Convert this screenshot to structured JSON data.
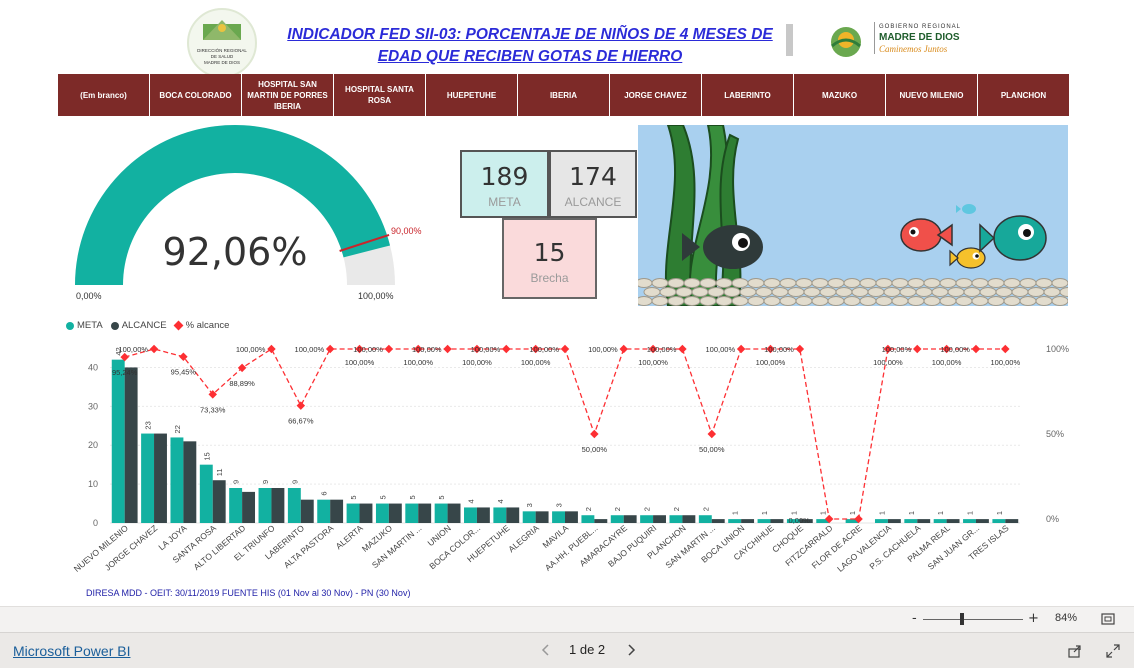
{
  "header": {
    "title": "INDICADOR FED SII-03: PORCENTAJE DE NIÑOS DE 4 MESES DE EDAD QUE RECIBEN GOTAS DE HIERRO",
    "logo_left_text": "DIRECCIÓN REGIONAL DE SALUD MADRE DE DIOS",
    "logo_right_line1": "GOBIERNO REGIONAL",
    "logo_right_line2": "MADRE DE DIOS",
    "logo_right_line3": "Caminemos Juntos"
  },
  "slicers": [
    "(Em branco)",
    "BOCA COLORADO",
    "HOSPITAL SAN MARTIN DE PORRES IBERIA",
    "HOSPITAL SANTA ROSA",
    "HUEPETUHE",
    "IBERIA",
    "JORGE CHAVEZ",
    "LABERINTO",
    "MAZUKO",
    "NUEVO MILENIO",
    "PLANCHON"
  ],
  "gauge": {
    "value_label": "92,06%",
    "value": 0.9206,
    "target": 0.9,
    "target_label": "90,00%",
    "min_label": "0,00%",
    "max_label": "100,00%",
    "color": "#12b1a1",
    "bg_color": "#e9e9e9",
    "target_color": "#c9252b"
  },
  "cards": {
    "meta": {
      "value": "189",
      "label": "META",
      "bg": "#ccefed"
    },
    "alcance": {
      "value": "174",
      "label": "ALCANCE",
      "bg": "#e6e6e6"
    },
    "brecha": {
      "value": "15",
      "label": "Brecha",
      "bg": "#fadadb"
    }
  },
  "legend": {
    "meta": "META",
    "alcance": "ALCANCE",
    "pct": "% alcance"
  },
  "chart_data": {
    "type": "bar",
    "categories": [
      "NUEVO MILENIO",
      "JORGE CHAVEZ",
      "LA JOYA",
      "SANTA ROSA",
      "ALTO LIBERTAD",
      "EL TRIUNFO",
      "LABERINTO",
      "ALTA PASTORA",
      "ALERTA",
      "MAZUKO",
      "SAN MARTIN ...",
      "UNION",
      "BOCA COLOR...",
      "HUEPETUHE",
      "ALEGRIA",
      "MAVILA",
      "AA.HH. PUEBL...",
      "AMARACAYRE",
      "BAJO PUQUIRI",
      "PLANCHON",
      "SAN MARTIN ...",
      "BOCA UNION",
      "CAYCHIHUE",
      "CHOQUE",
      "FITZCARRALD",
      "FLOR DE ACRE",
      "LAGO VALENCIA",
      "P.S. CACHUELA",
      "PALMA REAL",
      "SAN JUAN GR...",
      "TRES ISLAS"
    ],
    "series": [
      {
        "name": "META",
        "color": "#12b1a1",
        "values": [
          42,
          23,
          22,
          15,
          9,
          9,
          9,
          6,
          5,
          5,
          5,
          5,
          4,
          4,
          3,
          3,
          2,
          2,
          2,
          2,
          2,
          1,
          1,
          1,
          1,
          1,
          1,
          1,
          1,
          1,
          1
        ]
      },
      {
        "name": "ALCANCE",
        "color": "#374649",
        "values": [
          40,
          23,
          21,
          11,
          8,
          9,
          6,
          6,
          5,
          5,
          5,
          5,
          4,
          4,
          3,
          3,
          1,
          2,
          2,
          2,
          1,
          1,
          1,
          1,
          0,
          0,
          1,
          1,
          1,
          1,
          1
        ]
      },
      {
        "name": "% alcance",
        "color": "#fd2f33",
        "axis": "right",
        "values": [
          95.24,
          100,
          95.45,
          73.33,
          88.89,
          100,
          66.67,
          100,
          100,
          100,
          100,
          100,
          100,
          100,
          100,
          100,
          50,
          100,
          100,
          100,
          50,
          100,
          100,
          100,
          0,
          0,
          100,
          100,
          100,
          100,
          100
        ],
        "labels": [
          "95,24%",
          "100,00%",
          "95,45%",
          "73,33%",
          "88,89%",
          "100,00%",
          "66,67%",
          "100,00%",
          "100,00%",
          "100,00%",
          "100,00%",
          "100,00%",
          "100,00%",
          "100,00%",
          "100,00%",
          "100,00%",
          "50,00%",
          "100,00%",
          "100,00%",
          "100,00%",
          "50,00%",
          "100,00%",
          "100,00%",
          "100,00%",
          "0,00%",
          "",
          "100,00%",
          "100,00%",
          "100,00%",
          "100,00%",
          "100,00%"
        ]
      }
    ],
    "meta_labels": [
      "42",
      "23",
      "22",
      "15",
      "9",
      "9",
      "9",
      "6",
      "5",
      "5",
      "5",
      "5",
      "4",
      "4",
      "3",
      "3",
      "2",
      "2",
      "2",
      "2",
      "2",
      "1",
      "1",
      "1",
      "1",
      "1",
      "1",
      "1",
      "1",
      "1",
      "1"
    ],
    "alcance_labels": [
      "",
      "",
      "",
      "11",
      "",
      "",
      "",
      "",
      "",
      "",
      "",
      "",
      "",
      "",
      "",
      "",
      "",
      "",
      "",
      "",
      "",
      "",
      "",
      "",
      "",
      "",
      "",
      "",
      "",
      "",
      ""
    ],
    "ylim": [
      0,
      45
    ],
    "yticks": [
      "0",
      "10",
      "20",
      "30",
      "40"
    ],
    "y2ticks": [
      "0%",
      "50%",
      "100%"
    ],
    "legend_position": "top-left"
  },
  "footer": {
    "source": "DIRESA MDD - OEIT:  30/11/2019 FUENTE HIS (01 Nov al 30 Nov) - PN (30 Nov)"
  },
  "statusbar": {
    "zoom_minus": "-",
    "zoom_plus": "+",
    "zoom": "84%",
    "app_name": "Microsoft Power BI",
    "page": "1 de 2"
  }
}
